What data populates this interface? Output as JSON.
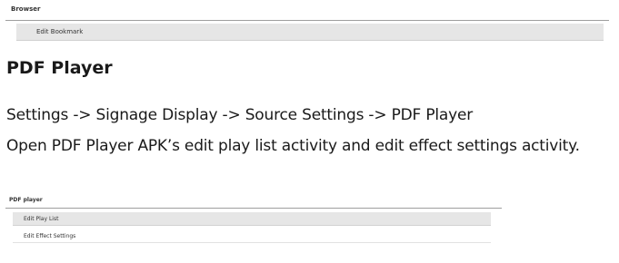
{
  "browser_panel": {
    "title": "Browser",
    "items": [
      {
        "label": "Edit Bookmark"
      }
    ]
  },
  "document": {
    "heading": "PDF Player",
    "path": "Settings -> Signage Display -> Source Settings -> PDF Player",
    "description": "Open PDF Player APK’s edit play list activity and edit effect settings activity."
  },
  "pdf_player_panel": {
    "title": "PDF player",
    "items": [
      {
        "label": "Edit Play List"
      },
      {
        "label": "Edit Effect Settings"
      }
    ]
  }
}
